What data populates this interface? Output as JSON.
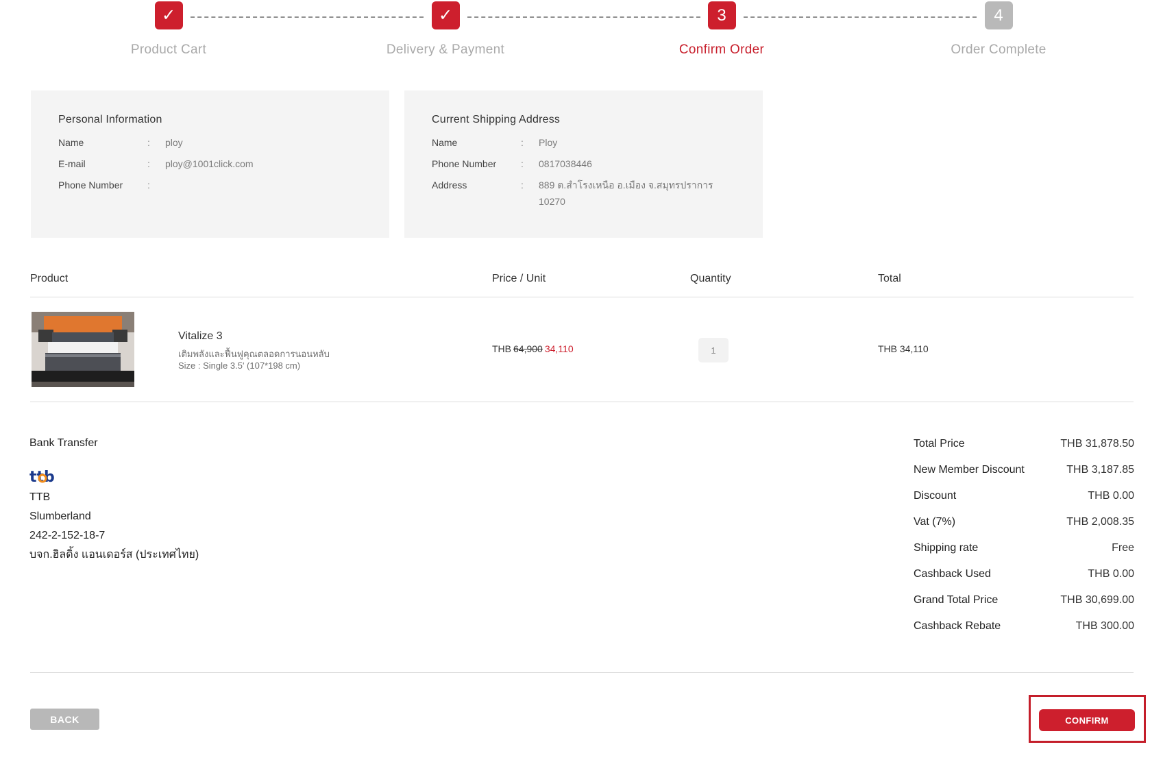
{
  "stepper": {
    "steps": [
      {
        "label": "Product Cart",
        "mark": "✓",
        "state": "done"
      },
      {
        "label": "Delivery & Payment",
        "mark": "✓",
        "state": "done"
      },
      {
        "label": "Confirm Order",
        "mark": "3",
        "state": "active"
      },
      {
        "label": "Order Complete",
        "mark": "4",
        "state": "pending"
      }
    ]
  },
  "personal": {
    "title": "Personal Information",
    "name_label": "Name",
    "name_value": "ploy",
    "email_label": "E-mail",
    "email_value": "ploy@1001click.com",
    "phone_label": "Phone Number",
    "phone_value": ""
  },
  "shipping": {
    "title": "Current Shipping Address",
    "name_label": "Name",
    "name_value": "Ploy",
    "phone_label": "Phone Number",
    "phone_value": "0817038446",
    "address_label": "Address",
    "address_line1": "889 ต.สำโรงเหนือ อ.เมือง จ.สมุทรปราการ",
    "address_line2": "10270"
  },
  "table": {
    "headers": {
      "product": "Product",
      "price": "Price / Unit",
      "quantity": "Quantity",
      "total": "Total"
    },
    "items": [
      {
        "name": "Vitalize 3",
        "description": "เติมพลังและฟื้นฟูคุณตลอดการนอนหลับ",
        "size": "Size : Single 3.5' (107*198 cm)",
        "currency": "THB",
        "old_price": "64,900",
        "new_price": "34,110",
        "quantity": "1",
        "total": "THB 34,110"
      }
    ]
  },
  "bank": {
    "heading": "Bank Transfer",
    "logo_text": "ttb",
    "bank_name": "TTB",
    "account_name": "Slumberland",
    "account_number": "242-2-152-18-7",
    "company": "บจก.ฮิลดิ้ง แอนเดอร์ส (ประเทศไทย)"
  },
  "summary": [
    {
      "label": "Total Price",
      "value": "THB 31,878.50"
    },
    {
      "label": "New Member Discount",
      "value": "THB 3,187.85"
    },
    {
      "label": "Discount",
      "value": "THB 0.00"
    },
    {
      "label": "Vat (7%)",
      "value": "THB 2,008.35"
    },
    {
      "label": "Shipping rate",
      "value": "Free"
    },
    {
      "label": "Cashback Used",
      "value": "THB 0.00"
    },
    {
      "label": "Grand Total Price",
      "value": "THB 30,699.00"
    },
    {
      "label": "Cashback Rebate",
      "value": "THB 300.00"
    }
  ],
  "buttons": {
    "back": "BACK",
    "confirm": "CONFIRM"
  },
  "colors": {
    "accent": "#cd1f2d",
    "pending": "#b9b9b9",
    "card_bg": "#f4f4f4"
  }
}
